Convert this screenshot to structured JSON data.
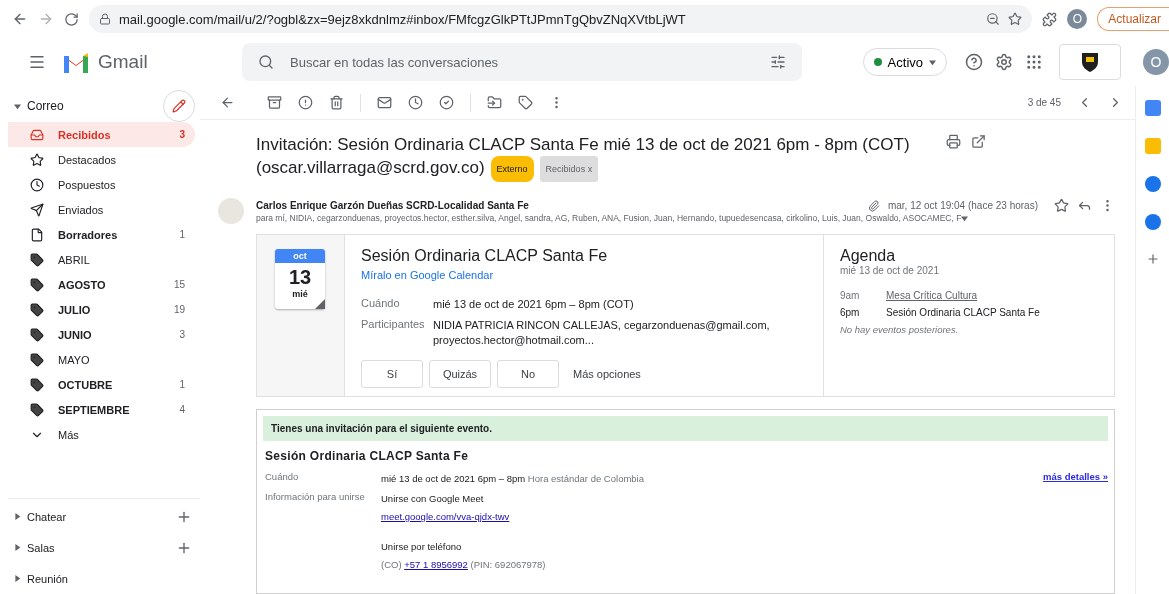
{
  "browser": {
    "url": "mail.google.com/mail/u/2/?ogbl&zx=9ejz8xkdnlmz#inbox/FMfcgzGlkPTtJPmnTgQbvZNqXVtbLjWT",
    "profile": "O",
    "update_button": "Actualizar"
  },
  "header": {
    "app_name": "Gmail",
    "search": {
      "placeholder": "Buscar en todas las conversaciones"
    },
    "status": {
      "label": "Activo",
      "on": true
    },
    "account": "O"
  },
  "sidebar": {
    "section": "Correo",
    "items": [
      {
        "kind": "inbox",
        "label": "Recibidos",
        "count": "3",
        "bold": true,
        "selected": true
      },
      {
        "kind": "star",
        "label": "Destacados",
        "bold": false,
        "selected": false
      },
      {
        "kind": "clock",
        "label": "Pospuestos",
        "bold": false,
        "selected": false
      },
      {
        "kind": "send",
        "label": "Enviados",
        "bold": false,
        "selected": false
      },
      {
        "kind": "draft",
        "label": "Borradores",
        "count": "1",
        "bold": true,
        "selected": false
      },
      {
        "kind": "label",
        "label": "ABRIL",
        "bold": false,
        "selected": false
      },
      {
        "kind": "label",
        "label": "AGOSTO",
        "count": "15",
        "bold": true,
        "selected": false
      },
      {
        "kind": "label",
        "label": "JULIO",
        "count": "19",
        "bold": true,
        "selected": false
      },
      {
        "kind": "label",
        "label": "JUNIO",
        "count": "3",
        "bold": true,
        "selected": false
      },
      {
        "kind": "label",
        "label": "MAYO",
        "bold": false,
        "selected": false
      },
      {
        "kind": "label",
        "label": "OCTUBRE",
        "count": "1",
        "bold": true,
        "selected": false
      },
      {
        "kind": "label",
        "label": "SEPTIEMBRE",
        "count": "4",
        "bold": true,
        "selected": false
      },
      {
        "kind": "more",
        "label": "Más",
        "bold": false,
        "selected": false
      }
    ],
    "bottom_sections": [
      {
        "label": "Chatear",
        "addable": true
      },
      {
        "label": "Salas",
        "addable": true
      },
      {
        "label": "Reunión",
        "addable": false
      }
    ]
  },
  "toolbar": {
    "pager": "3 de 45"
  },
  "message": {
    "subject": "Invitación: Sesión Ordinaria CLACP Santa Fe mié 13 de oct de 2021 6pm - 8pm (COT) (oscar.villarraga@scrd.gov.co)",
    "tags": [
      {
        "kind": "external",
        "label": "Externo"
      },
      {
        "kind": "folder",
        "label": "Recibidos",
        "close": "x"
      }
    ],
    "sender": "Carlos Enrique Garzón Dueñas SCRD-Localidad Santa Fe",
    "date": "mar, 12 oct 19:04 (hace 23 horas)",
    "has_attachment": true,
    "starred": false,
    "recipients": "para mí, NIDIA, cegarzonduenas, proyectos.hector, esther.silva, Angel, sandra, AG, Ruben, ANA, Fusion, Juan, Hernando, tupuedesencasa, cirkolino, Luis, Juan, Oswaldo, ASOCAMEC, F"
  },
  "calendar_card": {
    "month": "oct",
    "day": "13",
    "weekday": "mié",
    "title": "Sesión Ordinaria CLACP Santa Fe",
    "calendar_link": "Míralo en Google Calendar",
    "details": [
      {
        "label": "Cuándo",
        "value": "mié 13 de oct de 2021 6pm – 8pm (COT)"
      },
      {
        "label": "Participantes",
        "value": "NIDIA PATRICIA RINCON CALLEJAS, cegarzonduenas@gmail.com, proyectos.hector@hotmail.com..."
      }
    ],
    "rsvp": [
      {
        "kind": "button",
        "label": "Sí"
      },
      {
        "kind": "button",
        "label": "Quizás"
      },
      {
        "kind": "button",
        "label": "No"
      },
      {
        "kind": "text",
        "label": "Más opciones"
      }
    ],
    "agenda": {
      "title": "Agenda",
      "date": "mié 13 de oct de 2021",
      "events": [
        {
          "time": "9am",
          "title": "Mesa Crítica Cultura",
          "current": false
        },
        {
          "time": "6pm",
          "title": "Sesión Ordinaria CLACP Santa Fe",
          "current": true
        }
      ],
      "note": "No hay eventos posteriores."
    }
  },
  "invitation": {
    "banner": "Tienes una invitación para el siguiente evento.",
    "title": "Sesión Ordinaria CLACP Santa Fe",
    "when": {
      "label": "Cuándo",
      "value": "mié 13 de oct de 2021 6pm – 8pm",
      "zone": "Hora estándar de Colombia",
      "details_link": "más detalles »"
    },
    "join": {
      "label": "Información para unirse",
      "meet_title": "Unirse con Google Meet",
      "meet_link": "meet.google.com/vva-qjdx-twv",
      "phone_title": "Unirse por teléfono",
      "phone_prefix": "(CO)",
      "phone_link": "+57 1 8956992",
      "phone_pin": "(PIN: 692067978)"
    }
  }
}
